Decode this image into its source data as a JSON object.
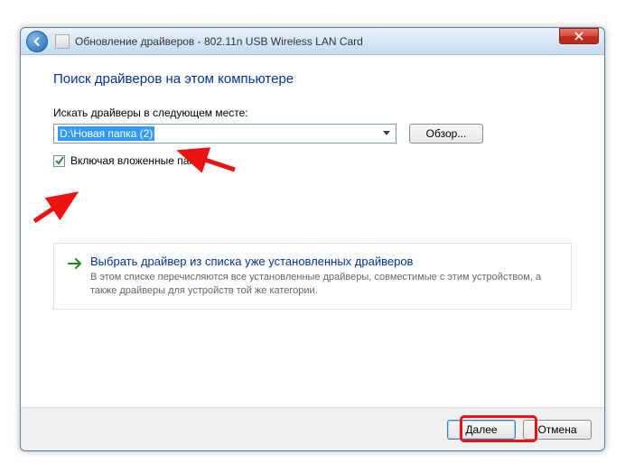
{
  "window": {
    "title": "Обновление драйверов - 802.11n USB Wireless LAN Card"
  },
  "heading": "Поиск драйверов на этом компьютере",
  "path_label": "Искать драйверы в следующем месте:",
  "path_value": "D:\\Новая папка (2)",
  "browse_label": "Обзор...",
  "include_sub_label": "Включая вложенные папки",
  "include_sub_checked": true,
  "info": {
    "title": "Выбрать драйвер из списка уже установленных драйверов",
    "desc": "В этом списке перечисляются все установленные драйверы, совместимые с этим устройством, а также драйверы для устройств той же категории."
  },
  "footer": {
    "next": "Далее",
    "cancel": "Отмена"
  }
}
